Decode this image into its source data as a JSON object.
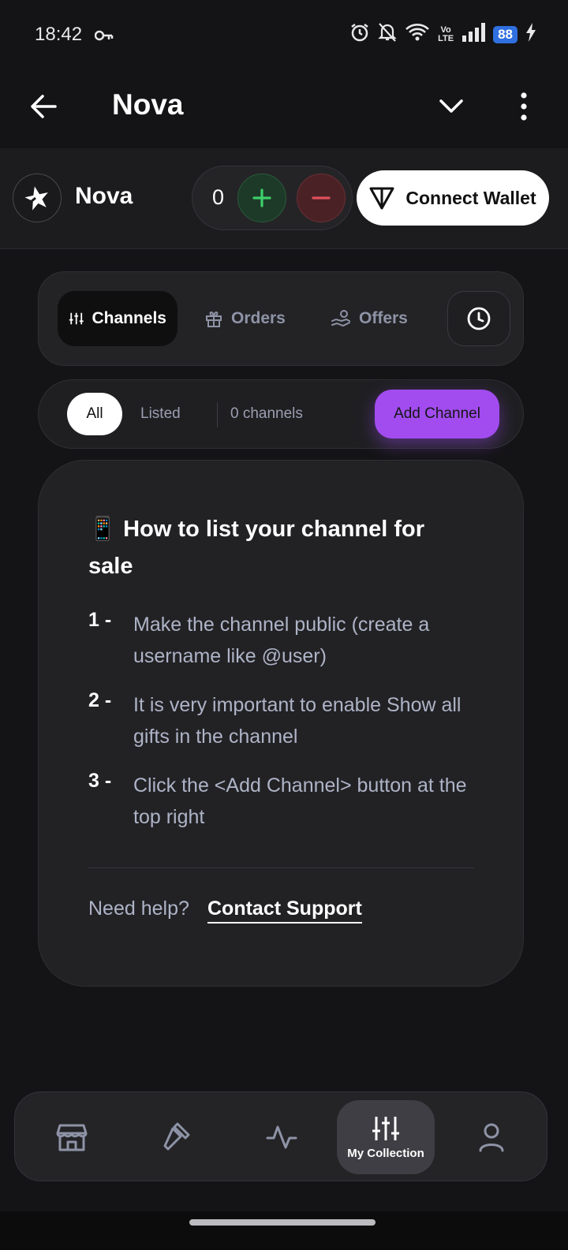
{
  "status_bar": {
    "time": "18:42",
    "battery": "88",
    "network": "Vo LTE"
  },
  "app_bar": {
    "title": "Nova"
  },
  "profile": {
    "name": "Nova",
    "counter": "0",
    "connect_wallet_label": "Connect Wallet"
  },
  "tabs": [
    {
      "label": "Channels",
      "icon": "sliders-icon",
      "active": true
    },
    {
      "label": "Orders",
      "icon": "gift-icon",
      "active": false
    },
    {
      "label": "Offers",
      "icon": "hand-coins-icon",
      "active": false
    }
  ],
  "filter": {
    "all_label": "All",
    "listed_label": "Listed",
    "count_text": "0 channels",
    "add_channel_label": "Add Channel"
  },
  "info": {
    "title": "📱 How to list your channel for sale",
    "steps": [
      {
        "num": "1 -",
        "text": "Make the channel public (create a username like @user)"
      },
      {
        "num": "2 -",
        "text": "It is very important to enable Show all gifts in the channel"
      },
      {
        "num": "3 -",
        "text": "Click the <Add Channel> button at the top right"
      }
    ],
    "help_text": "Need help?",
    "contact_label": "Contact Support"
  },
  "bottom_nav": {
    "items": [
      {
        "name": "store-icon",
        "label": ""
      },
      {
        "name": "hammer-icon",
        "label": ""
      },
      {
        "name": "activity-icon",
        "label": ""
      },
      {
        "name": "sliders-icon",
        "label": "My Collection"
      },
      {
        "name": "user-icon",
        "label": ""
      }
    ],
    "active_label": "My Collection"
  },
  "colors": {
    "background": "#141416",
    "card": "#222225",
    "accent_purple": "#a24cf0",
    "plus_green": "#3ecf6a",
    "minus_red": "#e0505a",
    "muted_text": "#aeb4c7"
  }
}
